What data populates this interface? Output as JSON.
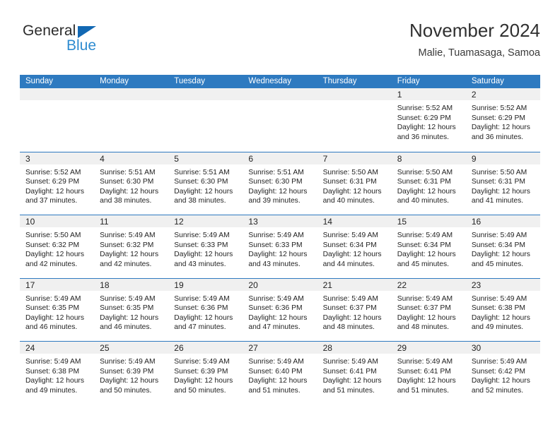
{
  "logo": {
    "word_one": "General",
    "word_two": "Blue",
    "triangle_icon": "triangle-icon",
    "accent_dark": "#1268b3",
    "accent_light": "#2e8bd0"
  },
  "header": {
    "title": "November 2024",
    "subtitle": "Malie, Tuamasaga, Samoa"
  },
  "theme": {
    "header_blue": "#2e7ac0",
    "day_strip_gray": "#f0f0f0",
    "text": "#232323"
  },
  "calendar": {
    "weekdays": [
      "Sunday",
      "Monday",
      "Tuesday",
      "Wednesday",
      "Thursday",
      "Friday",
      "Saturday"
    ],
    "weeks": [
      [
        {
          "day": "",
          "empty": true,
          "lines": []
        },
        {
          "day": "",
          "empty": true,
          "lines": []
        },
        {
          "day": "",
          "empty": true,
          "lines": []
        },
        {
          "day": "",
          "empty": true,
          "lines": []
        },
        {
          "day": "",
          "empty": true,
          "lines": []
        },
        {
          "day": "1",
          "empty": false,
          "lines": [
            "Sunrise: 5:52 AM",
            "Sunset: 6:29 PM",
            "Daylight: 12 hours",
            "and 36 minutes."
          ]
        },
        {
          "day": "2",
          "empty": false,
          "lines": [
            "Sunrise: 5:52 AM",
            "Sunset: 6:29 PM",
            "Daylight: 12 hours",
            "and 36 minutes."
          ]
        }
      ],
      [
        {
          "day": "3",
          "empty": false,
          "lines": [
            "Sunrise: 5:52 AM",
            "Sunset: 6:29 PM",
            "Daylight: 12 hours",
            "and 37 minutes."
          ]
        },
        {
          "day": "4",
          "empty": false,
          "lines": [
            "Sunrise: 5:51 AM",
            "Sunset: 6:30 PM",
            "Daylight: 12 hours",
            "and 38 minutes."
          ]
        },
        {
          "day": "5",
          "empty": false,
          "lines": [
            "Sunrise: 5:51 AM",
            "Sunset: 6:30 PM",
            "Daylight: 12 hours",
            "and 38 minutes."
          ]
        },
        {
          "day": "6",
          "empty": false,
          "lines": [
            "Sunrise: 5:51 AM",
            "Sunset: 6:30 PM",
            "Daylight: 12 hours",
            "and 39 minutes."
          ]
        },
        {
          "day": "7",
          "empty": false,
          "lines": [
            "Sunrise: 5:50 AM",
            "Sunset: 6:31 PM",
            "Daylight: 12 hours",
            "and 40 minutes."
          ]
        },
        {
          "day": "8",
          "empty": false,
          "lines": [
            "Sunrise: 5:50 AM",
            "Sunset: 6:31 PM",
            "Daylight: 12 hours",
            "and 40 minutes."
          ]
        },
        {
          "day": "9",
          "empty": false,
          "lines": [
            "Sunrise: 5:50 AM",
            "Sunset: 6:31 PM",
            "Daylight: 12 hours",
            "and 41 minutes."
          ]
        }
      ],
      [
        {
          "day": "10",
          "empty": false,
          "lines": [
            "Sunrise: 5:50 AM",
            "Sunset: 6:32 PM",
            "Daylight: 12 hours",
            "and 42 minutes."
          ]
        },
        {
          "day": "11",
          "empty": false,
          "lines": [
            "Sunrise: 5:49 AM",
            "Sunset: 6:32 PM",
            "Daylight: 12 hours",
            "and 42 minutes."
          ]
        },
        {
          "day": "12",
          "empty": false,
          "lines": [
            "Sunrise: 5:49 AM",
            "Sunset: 6:33 PM",
            "Daylight: 12 hours",
            "and 43 minutes."
          ]
        },
        {
          "day": "13",
          "empty": false,
          "lines": [
            "Sunrise: 5:49 AM",
            "Sunset: 6:33 PM",
            "Daylight: 12 hours",
            "and 43 minutes."
          ]
        },
        {
          "day": "14",
          "empty": false,
          "lines": [
            "Sunrise: 5:49 AM",
            "Sunset: 6:34 PM",
            "Daylight: 12 hours",
            "and 44 minutes."
          ]
        },
        {
          "day": "15",
          "empty": false,
          "lines": [
            "Sunrise: 5:49 AM",
            "Sunset: 6:34 PM",
            "Daylight: 12 hours",
            "and 45 minutes."
          ]
        },
        {
          "day": "16",
          "empty": false,
          "lines": [
            "Sunrise: 5:49 AM",
            "Sunset: 6:34 PM",
            "Daylight: 12 hours",
            "and 45 minutes."
          ]
        }
      ],
      [
        {
          "day": "17",
          "empty": false,
          "lines": [
            "Sunrise: 5:49 AM",
            "Sunset: 6:35 PM",
            "Daylight: 12 hours",
            "and 46 minutes."
          ]
        },
        {
          "day": "18",
          "empty": false,
          "lines": [
            "Sunrise: 5:49 AM",
            "Sunset: 6:35 PM",
            "Daylight: 12 hours",
            "and 46 minutes."
          ]
        },
        {
          "day": "19",
          "empty": false,
          "lines": [
            "Sunrise: 5:49 AM",
            "Sunset: 6:36 PM",
            "Daylight: 12 hours",
            "and 47 minutes."
          ]
        },
        {
          "day": "20",
          "empty": false,
          "lines": [
            "Sunrise: 5:49 AM",
            "Sunset: 6:36 PM",
            "Daylight: 12 hours",
            "and 47 minutes."
          ]
        },
        {
          "day": "21",
          "empty": false,
          "lines": [
            "Sunrise: 5:49 AM",
            "Sunset: 6:37 PM",
            "Daylight: 12 hours",
            "and 48 minutes."
          ]
        },
        {
          "day": "22",
          "empty": false,
          "lines": [
            "Sunrise: 5:49 AM",
            "Sunset: 6:37 PM",
            "Daylight: 12 hours",
            "and 48 minutes."
          ]
        },
        {
          "day": "23",
          "empty": false,
          "lines": [
            "Sunrise: 5:49 AM",
            "Sunset: 6:38 PM",
            "Daylight: 12 hours",
            "and 49 minutes."
          ]
        }
      ],
      [
        {
          "day": "24",
          "empty": false,
          "lines": [
            "Sunrise: 5:49 AM",
            "Sunset: 6:38 PM",
            "Daylight: 12 hours",
            "and 49 minutes."
          ]
        },
        {
          "day": "25",
          "empty": false,
          "lines": [
            "Sunrise: 5:49 AM",
            "Sunset: 6:39 PM",
            "Daylight: 12 hours",
            "and 50 minutes."
          ]
        },
        {
          "day": "26",
          "empty": false,
          "lines": [
            "Sunrise: 5:49 AM",
            "Sunset: 6:39 PM",
            "Daylight: 12 hours",
            "and 50 minutes."
          ]
        },
        {
          "day": "27",
          "empty": false,
          "lines": [
            "Sunrise: 5:49 AM",
            "Sunset: 6:40 PM",
            "Daylight: 12 hours",
            "and 51 minutes."
          ]
        },
        {
          "day": "28",
          "empty": false,
          "lines": [
            "Sunrise: 5:49 AM",
            "Sunset: 6:41 PM",
            "Daylight: 12 hours",
            "and 51 minutes."
          ]
        },
        {
          "day": "29",
          "empty": false,
          "lines": [
            "Sunrise: 5:49 AM",
            "Sunset: 6:41 PM",
            "Daylight: 12 hours",
            "and 51 minutes."
          ]
        },
        {
          "day": "30",
          "empty": false,
          "lines": [
            "Sunrise: 5:49 AM",
            "Sunset: 6:42 PM",
            "Daylight: 12 hours",
            "and 52 minutes."
          ]
        }
      ]
    ]
  }
}
